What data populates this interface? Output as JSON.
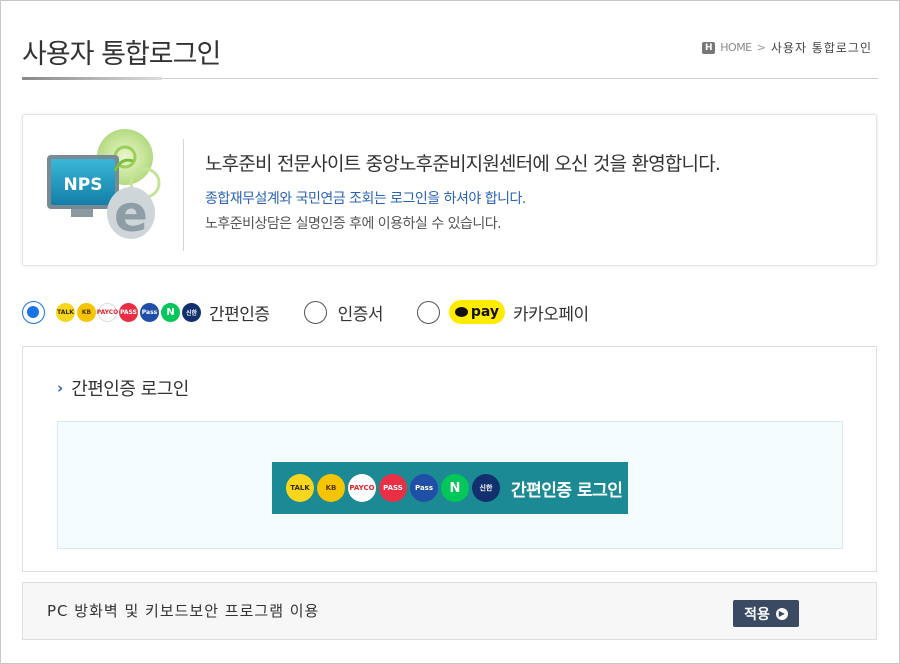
{
  "page": {
    "title": "사용자 통합로그인"
  },
  "breadcrumb": {
    "home_icon_text": "H",
    "home_label": "HOME",
    "separator": ">",
    "current": "사용자 통합로그인"
  },
  "welcome": {
    "logo_text": "NPS",
    "title": "노후준비 전문사이트 중앙노후준비지원센터에 오신 것을 환영합니다.",
    "line1": "종합재무설계와 국민연금 조회는 로그인을 하셔야 합니다.",
    "line2": "노후준비상담은 실명인증 후에 이용하실 수 있습니다."
  },
  "methods": {
    "options": [
      {
        "label": "간편인증",
        "selected": true
      },
      {
        "label": "인증서",
        "selected": false
      },
      {
        "label": "카카오페이",
        "selected": false,
        "badge_text": "pay"
      }
    ],
    "brand_icons": [
      "kakaotalk-icon",
      "kb-icon",
      "payco-icon",
      "pass-icon",
      "samsung-pass-icon",
      "naver-icon",
      "shinhan-icon"
    ],
    "mini_icon_text": [
      "TALK",
      "KB",
      "PAYCO",
      "PASS",
      "Pass",
      "N",
      "신한"
    ]
  },
  "login_panel": {
    "heading": "간편인증 로그인",
    "button_label": "간편인증 로그인",
    "button_icon_text": [
      "TALK",
      "KB",
      "PAYCO",
      "PASS",
      "Pass",
      "N",
      "신한"
    ]
  },
  "security": {
    "text": "PC 방화벽 및 키보드보안 프로그램 이용",
    "apply_label": "적용"
  },
  "colors": {
    "accent_blue": "#1a73e8",
    "link_blue": "#2a63b4",
    "easy_button_bg": "#1b8a94",
    "apply_button_bg": "#3b4a63",
    "kakao_yellow": "#ffeb00"
  }
}
